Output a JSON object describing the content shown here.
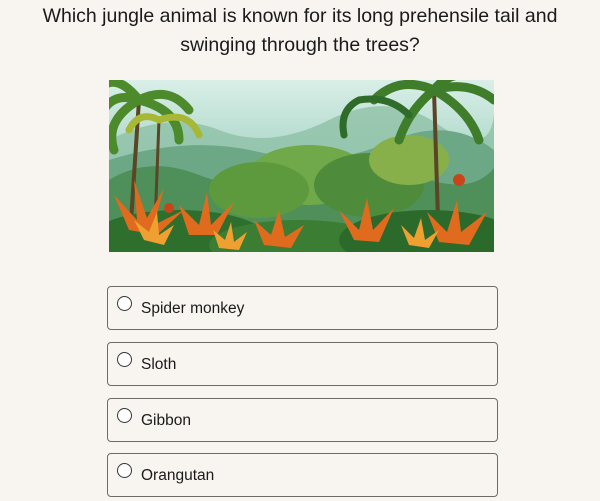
{
  "question": {
    "line1": "Which jungle animal is known for its long prehensile tail and",
    "line2": "swinging through the trees?"
  },
  "image": {
    "subject": "jungle-scene-illustration"
  },
  "options": [
    {
      "label": "Spider monkey",
      "selected": false
    },
    {
      "label": "Sloth",
      "selected": false
    },
    {
      "label": "Gibbon",
      "selected": false
    },
    {
      "label": "Orangutan",
      "selected": false
    }
  ],
  "colors": {
    "background": "#f8f5f0",
    "option_border": "#6f6a66",
    "text": "#1a1a1a"
  }
}
